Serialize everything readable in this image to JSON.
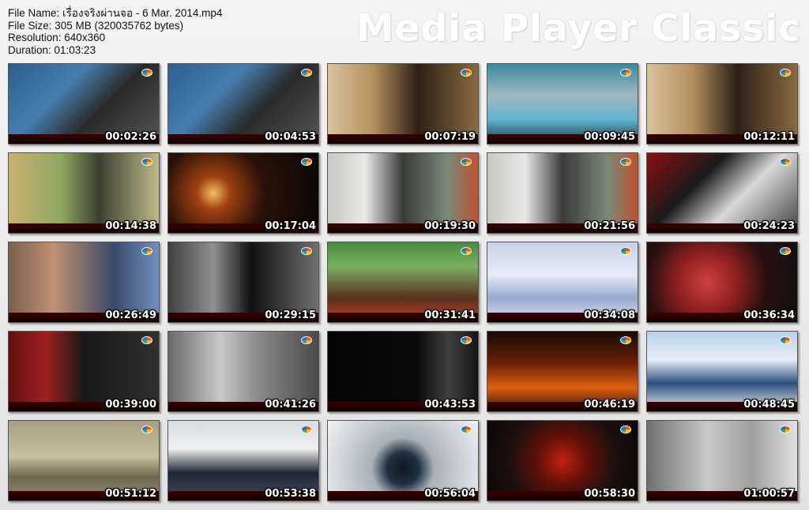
{
  "info": {
    "file_name": "File Name: เรื่องจริงผ่านจอ - 6 Mar. 2014.mp4",
    "file_size": "File Size: 305 MB (320035762 bytes)",
    "resolution": "Resolution: 640x360",
    "duration": "Duration: 01:03:23"
  },
  "brand": "Media Player Classic",
  "thumbnails": [
    {
      "time": "00:02:26",
      "bg": "linear-gradient(135deg,#2e5f8f 0%,#467db0 35%,#2a2a2a 60%,#555 100%)"
    },
    {
      "time": "00:04:53",
      "bg": "linear-gradient(135deg,#2e5f8f 0%,#467db0 35%,#2a2a2a 60%,#555 100%)"
    },
    {
      "time": "00:07:19",
      "bg": "linear-gradient(90deg,#d9c29a 0%,#b59060 30%,#2d2016 60%,#8a6a40 100%)"
    },
    {
      "time": "00:09:45",
      "bg": "linear-gradient(180deg,#3a8aa0 0%,#a0b8c0 40%,#5fb3d0 70%,#1f3340 100%)"
    },
    {
      "time": "00:12:11",
      "bg": "linear-gradient(90deg,#d9c29a 0%,#b59060 30%,#2d2016 60%,#8a6a40 100%)"
    },
    {
      "time": "00:14:38",
      "bg": "linear-gradient(90deg,#c8b070 0%,#8fa860 35%,#3a4030 60%,#c0b888 100%)"
    },
    {
      "time": "00:17:04",
      "bg": "radial-gradient(circle at 30% 50%,#f0c060 0%,#a04010 15%,#2a1208 45%,#0a0604 100%)"
    },
    {
      "time": "00:19:30",
      "bg": "linear-gradient(90deg,#c8c8c0 0%,#e8e8e8 25%,#3a3a3a 50%,#7a8a78 80%,#c05030 100%)"
    },
    {
      "time": "00:21:56",
      "bg": "linear-gradient(90deg,#c8c8c0 0%,#e8e8e8 25%,#3a3a3a 50%,#7a8a78 80%,#c05030 100%)"
    },
    {
      "time": "00:24:23",
      "bg": "linear-gradient(135deg,#8a1010 0%,#1a1a1a 35%,#d8d8d8 60%,#404040 100%)"
    },
    {
      "time": "00:26:49",
      "bg": "linear-gradient(90deg,#7a6050 0%,#c09070 30%,#3a4a6a 70%,#7090c0 100%)"
    },
    {
      "time": "00:29:15",
      "bg": "linear-gradient(90deg,#404040 0%,#909090 30%,#101010 55%,#707070 100%)"
    },
    {
      "time": "00:31:41",
      "bg": "linear-gradient(180deg,#4a8a40 0%,#7ab060 30%,#5a3020 70%,#c04020 100%)"
    },
    {
      "time": "00:34:08",
      "bg": "linear-gradient(180deg,#c8d0e8 0%,#e8ecf8 40%,#9aa8d0 70%,#dde2f2 100%)"
    },
    {
      "time": "00:36:34",
      "bg": "radial-gradient(circle at 40% 50%,#d04040 0%,#902020 30%,#2a1010 60%,#101010 100%)"
    },
    {
      "time": "00:39:00",
      "bg": "linear-gradient(90deg,#601010 0%,#a02020 25%,#181818 50%,#303030 100%)"
    },
    {
      "time": "00:41:26",
      "bg": "linear-gradient(90deg,#6a6a6a 0%,#c8c8c8 35%,#8a8a8a 60%,#4a4a4a 100%)"
    },
    {
      "time": "00:43:53",
      "bg": "linear-gradient(90deg,#050505 0%,#0a0a0a 60%,#404040 80%,#151515 100%)"
    },
    {
      "time": "00:46:19",
      "bg": "linear-gradient(180deg,#1a0a05 0%,#6a2008 40%,#e06010 70%,#301008 100%)"
    },
    {
      "time": "00:48:45",
      "bg": "linear-gradient(180deg,#b8d0e8 0%,#e8f0f8 35%,#2a5080 65%,#f0f0f0 100%)"
    },
    {
      "time": "00:51:12",
      "bg": "linear-gradient(180deg,#a8a080 0%,#c8c0a0 45%,#706850 70%,#908870 100%)"
    },
    {
      "time": "00:53:38",
      "bg": "linear-gradient(180deg,#d8dce0 0%,#f0f0f0 35%,#202838 65%,#404858 100%)"
    },
    {
      "time": "00:56:04",
      "bg": "radial-gradient(circle at 50% 60%,#101820 0%,#203040 18%,#a8b0b8 35%,#f0f4f8 100%)"
    },
    {
      "time": "00:58:30",
      "bg": "radial-gradient(circle at 50% 50%,#c02010 0%,#601008 30%,#201010 60%,#0a0505 100%)"
    },
    {
      "time": "01:00:57",
      "bg": "linear-gradient(90deg,#707070 0%,#c8c8c8 40%,#a0a0a0 70%,#e0e0e0 100%)"
    }
  ]
}
